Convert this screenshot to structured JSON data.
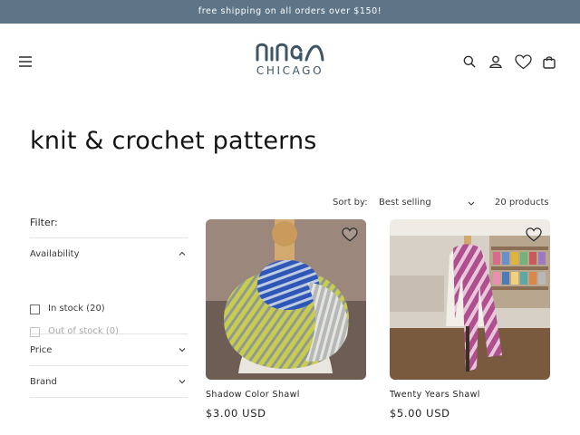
{
  "announcement": {
    "text": "free shipping on all orders over $150!"
  },
  "header": {
    "logo_script": "nina",
    "logo_sub": "CHICAGO",
    "icons": [
      "menu-icon",
      "search-icon",
      "account-icon",
      "heart-icon",
      "cart-icon"
    ]
  },
  "collection": {
    "title": "knit & crochet patterns"
  },
  "sort": {
    "label": "Sort by:",
    "value": "Best selling",
    "count": "20 products"
  },
  "filters": {
    "title": "Filter:",
    "availability": {
      "label": "Availability",
      "options": [
        {
          "label": "In stock (20)",
          "enabled": true
        },
        {
          "label": "Out of stock (0)",
          "enabled": false
        }
      ]
    },
    "price": {
      "label": "Price"
    },
    "brand": {
      "label": "Brand"
    }
  },
  "products": [
    {
      "title": "Shadow Color Shawl",
      "price": "$3.00 USD"
    },
    {
      "title": "Twenty Years Shawl",
      "price": "$5.00 USD"
    }
  ],
  "colors": {
    "announcement_bg": "#5e7588",
    "logo": "#3f5564",
    "text": "#1f1f1f"
  }
}
